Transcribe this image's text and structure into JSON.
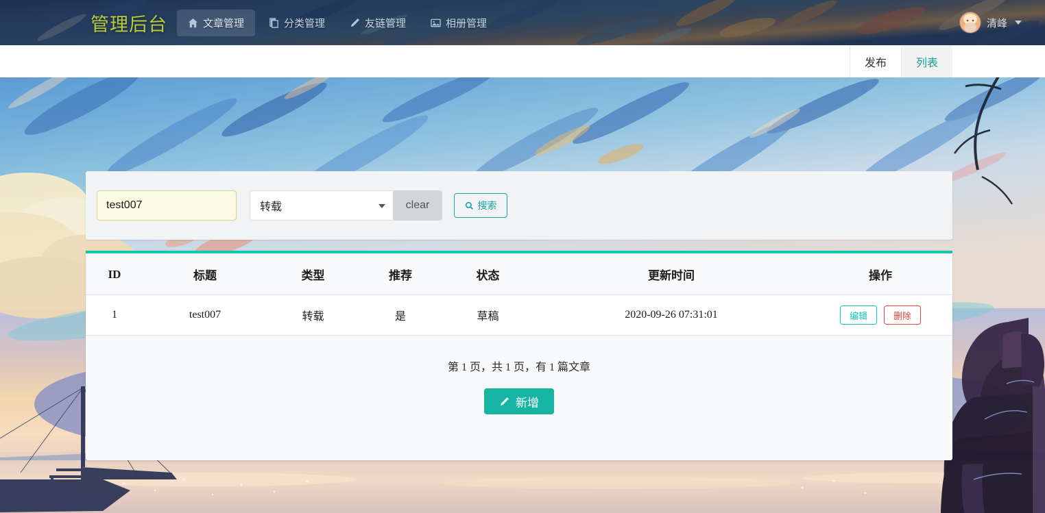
{
  "navbar": {
    "brand": "管理后台",
    "brand_color": "#b9cc3c",
    "items": [
      {
        "label": "文章管理",
        "icon": "home-icon",
        "active": true
      },
      {
        "label": "分类管理",
        "icon": "copy-icon",
        "active": false
      },
      {
        "label": "友链管理",
        "icon": "pencil-icon",
        "active": false
      },
      {
        "label": "相册管理",
        "icon": "image-icon",
        "active": false
      }
    ],
    "user": {
      "name": "清峰",
      "avatar": "user-avatar",
      "caret": "chevron-down-icon"
    }
  },
  "subnav": {
    "tabs": [
      {
        "label": "发布",
        "active": false
      },
      {
        "label": "列表",
        "active": true
      }
    ],
    "active_color": "#17a2a2"
  },
  "search": {
    "keyword_value": "test007",
    "keyword_placeholder": "",
    "type_selected": "转载",
    "type_caret": "caret-down-icon",
    "clear_label": "clear",
    "search_label": "搜索",
    "search_icon": "search-icon",
    "accent_color": "#17a2a2"
  },
  "table": {
    "accent_top_border": "#17c4b0",
    "columns": [
      "ID",
      "标题",
      "类型",
      "推荐",
      "状态",
      "更新时间",
      "操作"
    ],
    "rows": [
      {
        "id": "1",
        "title": "test007",
        "type": "转载",
        "recommend": "是",
        "status": "草稿",
        "updated_at": "2020-09-26 07:31:01",
        "edit_label": "编辑",
        "delete_label": "删除"
      }
    ]
  },
  "footer": {
    "pager_text": "第 1 页，共 1 页，有 1 篇文章",
    "add_label": "新增",
    "add_icon": "pencil-icon",
    "add_color": "#17b3a3"
  }
}
